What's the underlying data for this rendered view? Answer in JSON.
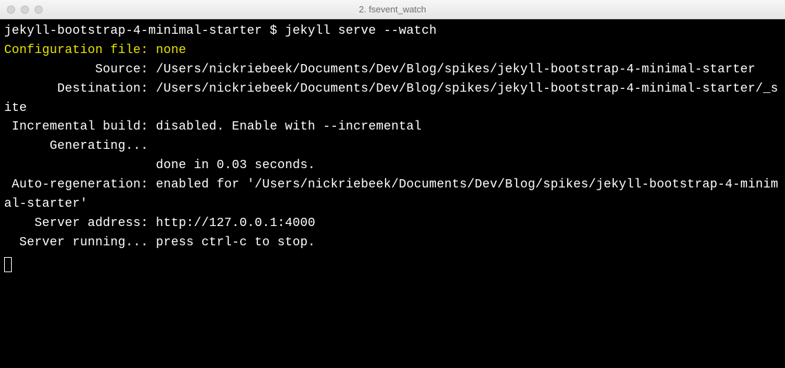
{
  "window": {
    "title": "2. fsevent_watch"
  },
  "term": {
    "prompt": "jekyll-bootstrap-4-minimal-starter $ ",
    "command": "jekyll serve --watch",
    "cfg_label": "Configuration file: ",
    "cfg_value": "none",
    "source": "            Source: /Users/nickriebeek/Documents/Dev/Blog/spikes/jekyll-bootstrap-4-minimal-starter",
    "destination": "       Destination: /Users/nickriebeek/Documents/Dev/Blog/spikes/jekyll-bootstrap-4-minimal-starter/_site",
    "incremental": " Incremental build: disabled. Enable with --incremental",
    "generating": "      Generating... ",
    "done": "                    done in 0.03 seconds.",
    "autoregen": " Auto-regeneration: enabled for '/Users/nickriebeek/Documents/Dev/Blog/spikes/jekyll-bootstrap-4-minimal-starter'",
    "server_addr": "    Server address: http://127.0.0.1:4000",
    "server_run": "  Server running... press ctrl-c to stop."
  }
}
